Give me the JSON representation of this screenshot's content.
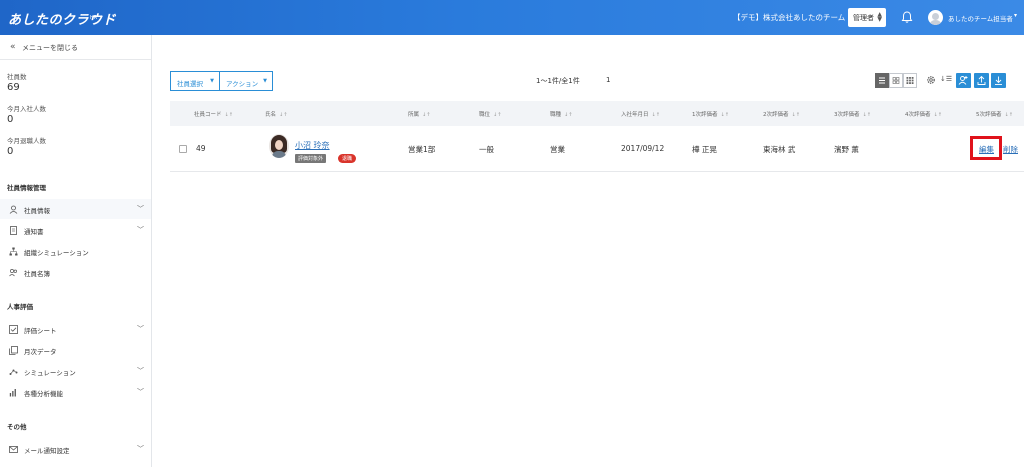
{
  "header": {
    "logo": "あしたのクラウド",
    "logo_sub": "HR",
    "company": "【デモ】株式会社あしたのチーム",
    "role_select": "管理者",
    "user_name": "あしたのチーム担当者"
  },
  "sidebar": {
    "close_menu": "メニューを閉じる",
    "stats": [
      {
        "label": "社員数",
        "value": "69"
      },
      {
        "label": "今月入社人数",
        "value": "0"
      },
      {
        "label": "今月退職人数",
        "value": "0"
      }
    ],
    "sections": [
      {
        "title": "社員情報管理",
        "items": [
          {
            "label": "社員情報",
            "icon": "person-icon",
            "chevron": true,
            "active": true
          },
          {
            "label": "通知書",
            "icon": "document-icon",
            "chevron": true
          },
          {
            "label": "組織シミュレーション",
            "icon": "org-chart-icon",
            "chevron": false
          },
          {
            "label": "社員名簿",
            "icon": "people-icon",
            "chevron": false
          }
        ]
      },
      {
        "title": "人事評価",
        "items": [
          {
            "label": "評価シート",
            "icon": "checklist-icon",
            "chevron": true
          },
          {
            "label": "月次データ",
            "icon": "copy-icon",
            "chevron": false
          },
          {
            "label": "シミュレーション",
            "icon": "simulation-icon",
            "chevron": true
          },
          {
            "label": "各種分析機能",
            "icon": "bar-chart-icon",
            "chevron": true
          }
        ]
      },
      {
        "title": "その他",
        "items": [
          {
            "label": "メール通知設定",
            "icon": "mail-icon",
            "chevron": true
          }
        ]
      }
    ]
  },
  "toolbar": {
    "select_employees": "社員選択",
    "actions": "アクション",
    "pager": "1〜1件/全1件",
    "page": "1"
  },
  "table": {
    "columns": [
      "社員コード",
      "氏名",
      "所属",
      "職位",
      "職種",
      "入社年月日",
      "1次評価者",
      "2次評価者",
      "3次評価者",
      "4次評価者",
      "5次評価者"
    ],
    "rows": [
      {
        "code": "49",
        "name": "小沼 玲奈",
        "badge_eval": "評価対象外",
        "badge_status": "退職",
        "department": "営業1部",
        "position": "一般",
        "job_type": "営業",
        "joined": "2017/09/12",
        "eval1": "樺 正晃",
        "eval2": "東海林 武",
        "eval3": "濱野 薫",
        "eval4": "",
        "eval5": "",
        "edit": "編集",
        "delete": "削除"
      }
    ]
  },
  "colors": {
    "header": "#2a7bdc",
    "accent": "#2a8ed6",
    "highlight": "#e0121b",
    "retired_badge": "#d9342b"
  }
}
